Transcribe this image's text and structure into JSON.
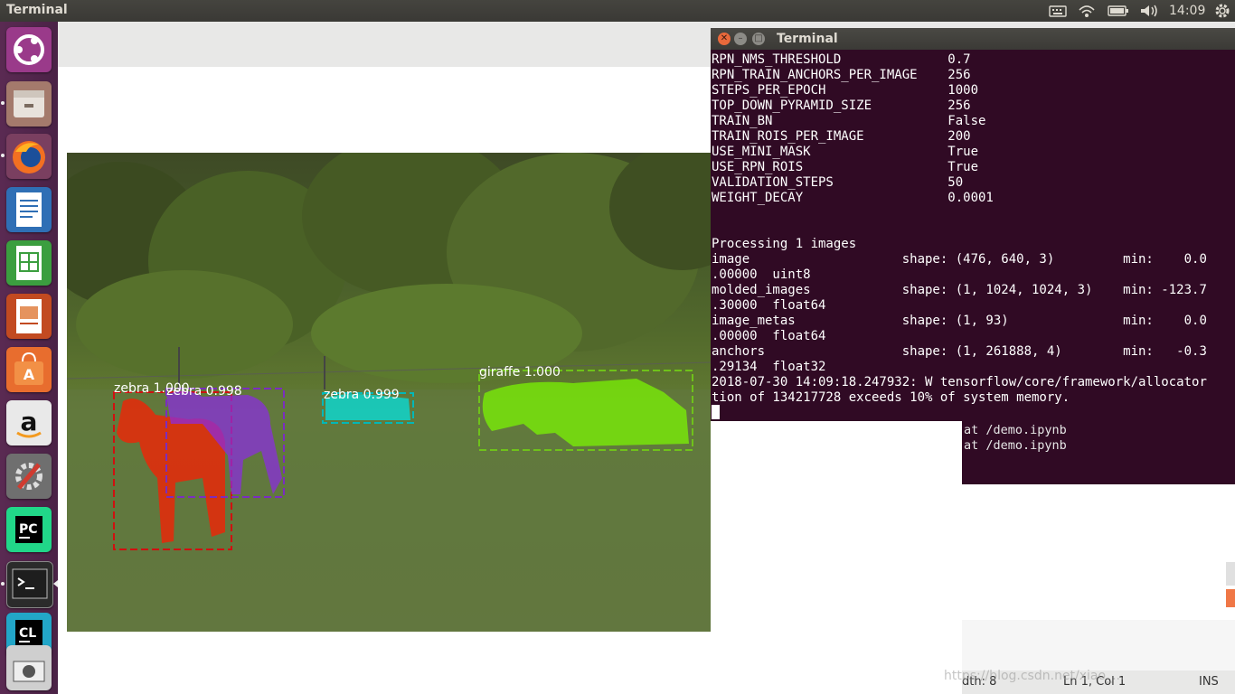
{
  "top_panel": {
    "app_title": "Terminal",
    "clock": "14:09",
    "tray_icons": [
      "keyboard-icon",
      "wifi-icon",
      "battery-icon",
      "volume-icon",
      "settings-icon"
    ]
  },
  "launcher": {
    "items": [
      "ubuntu-dash",
      "files",
      "firefox",
      "writer",
      "calc",
      "impress",
      "software-center",
      "amazon",
      "system-settings",
      "pycharm",
      "terminal",
      "clion",
      "screenshot-tool"
    ]
  },
  "figure": {
    "detections": [
      {
        "label": "zebra 1.000",
        "color": "#ff1a00"
      },
      {
        "label": "zebra 0.998",
        "color": "#8a2be2"
      },
      {
        "label": "zebra 0.999",
        "color": "#00e5e5"
      },
      {
        "label": "giraffe 1.000",
        "color": "#7cfc00"
      }
    ]
  },
  "terminal": {
    "title": "Terminal",
    "lines": [
      "RPN_NMS_THRESHOLD              0.7",
      "RPN_TRAIN_ANCHORS_PER_IMAGE    256",
      "STEPS_PER_EPOCH                1000",
      "TOP_DOWN_PYRAMID_SIZE          256",
      "TRAIN_BN                       False",
      "TRAIN_ROIS_PER_IMAGE           200",
      "USE_MINI_MASK                  True",
      "USE_RPN_ROIS                   True",
      "VALIDATION_STEPS               50",
      "WEIGHT_DECAY                   0.0001",
      "",
      "",
      "Processing 1 images",
      "image                    shape: (476, 640, 3)         min:    0.0",
      ".00000  uint8",
      "molded_images            shape: (1, 1024, 1024, 3)    min: -123.7",
      ".30000  float64",
      "image_metas              shape: (1, 93)               min:    0.0",
      ".00000  float64",
      "anchors                  shape: (1, 261888, 4)        min:   -0.3",
      ".29134  float32",
      "2018-07-30 14:09:18.247932: W tensorflow/core/framework/allocator",
      "tion of 134217728 exceeds 10% of system memory."
    ]
  },
  "background_terminal": {
    "lines": [
      "at /demo.ipynb",
      "at /demo.ipynb"
    ]
  },
  "editor_status": {
    "width": "dth: 8",
    "position": "Ln 1, Col 1",
    "mode": "INS"
  },
  "watermark": "https://blog.csdn.net/xiao_..."
}
